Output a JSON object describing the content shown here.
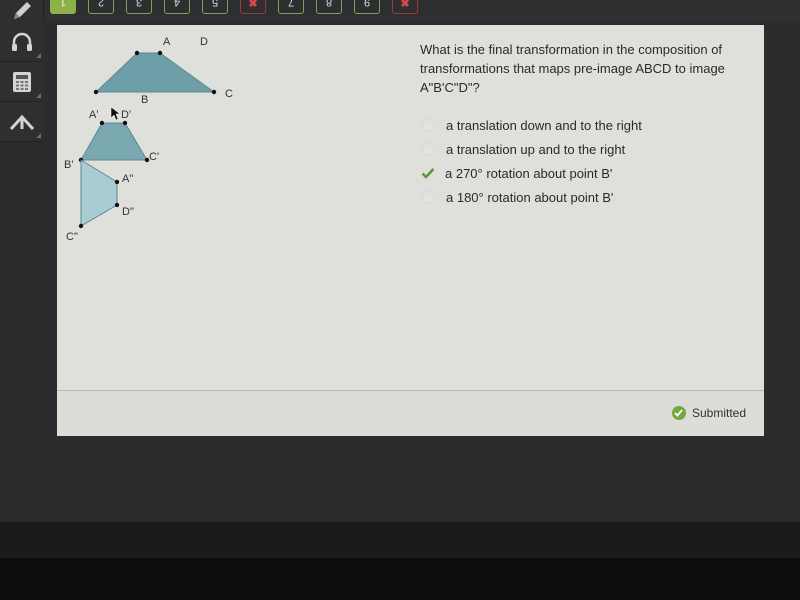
{
  "nav": {
    "tabs": [
      {
        "label": "1",
        "state": "active"
      },
      {
        "label": "2",
        "state": "normal"
      },
      {
        "label": "3",
        "state": "normal"
      },
      {
        "label": "4",
        "state": "normal"
      },
      {
        "label": "5",
        "state": "normal"
      },
      {
        "label": "✖",
        "state": "wrong"
      },
      {
        "label": "7",
        "state": "normal"
      },
      {
        "label": "8",
        "state": "normal"
      },
      {
        "label": "9",
        "state": "normal"
      },
      {
        "label": "✖",
        "state": "wrong"
      }
    ]
  },
  "tools": [
    "pencil-icon",
    "headphones-icon",
    "calculator-icon",
    "reference-arrow-icon"
  ],
  "figure": {
    "preimage_labels": {
      "A": "A",
      "B": "B",
      "C": "C",
      "D": "D"
    },
    "image1_labels": {
      "A": "A'",
      "B": "B'",
      "C": "C'",
      "D": "D'"
    },
    "image2_labels": {
      "A": "A\"",
      "C": "C\"",
      "D": "D\""
    }
  },
  "question": {
    "text": "What is the final transformation in the composition of transformations that maps pre-image ABCD to image A\"B'C\"D\"?",
    "options": [
      {
        "label": "a translation down and to the right",
        "selected": false
      },
      {
        "label": "a translation up and to the right",
        "selected": false
      },
      {
        "label": "a 270° rotation about point B'",
        "selected": true
      },
      {
        "label": "a 180° rotation about point B'",
        "selected": false
      }
    ]
  },
  "status": {
    "label": "Submitted"
  },
  "colors": {
    "accent_green": "#8cb14a",
    "wrong_red": "#d94848",
    "check_green": "#5a9a35",
    "shape_dark": "#6e9fa8",
    "shape_light": "#a9cbd2"
  }
}
